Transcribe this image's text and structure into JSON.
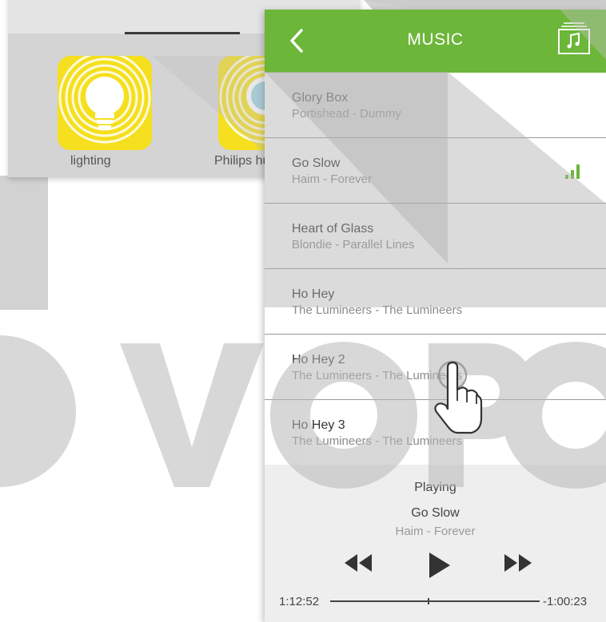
{
  "background": {
    "apps": [
      {
        "label": "lighting",
        "icon": "light-bulb-icon"
      },
      {
        "label": "Philips hue",
        "icon": "light-bulb-icon"
      }
    ]
  },
  "music": {
    "title": "MUSIC",
    "back_icon": "chevron-left-icon",
    "library_icon": "music-library-icon",
    "songs": [
      {
        "title": "Glory Box",
        "subtitle": "Portishead - Dummy"
      },
      {
        "title": "Go Slow",
        "subtitle": "Haim - Forever",
        "playing": true
      },
      {
        "title": "Heart of Glass",
        "subtitle": "Blondie -  Parallel Lines"
      },
      {
        "title": "Ho Hey",
        "subtitle": "The Lumineers - The Lumineers"
      },
      {
        "title": "Ho Hey 2",
        "subtitle": "The Lumineers - The Lumineers"
      },
      {
        "title": "Ho Hey 3",
        "subtitle": "The Lumineers - The Lumineers"
      }
    ],
    "player": {
      "status": "Playing",
      "title": "Go Slow",
      "artist": "Haim - Forever",
      "elapsed": "1:12:52",
      "remaining": "-1:00:23",
      "progress": 0.47,
      "controls": [
        "rewind-icon",
        "play-icon",
        "fast-forward-icon"
      ]
    }
  },
  "colors": {
    "accent": "#6cb63a",
    "tile": "#f5df1e",
    "player_bg": "#eeeeee"
  },
  "watermark": "OVOPO"
}
